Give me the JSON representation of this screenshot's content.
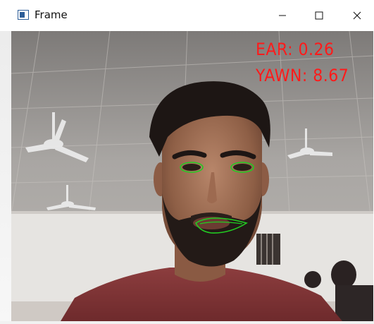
{
  "window": {
    "title": "Frame",
    "icons": {
      "app": "window-app-icon",
      "minimize": "minimize-icon",
      "maximize": "maximize-icon",
      "close": "close-icon"
    }
  },
  "overlay": {
    "ear_text": "EAR: 0.26",
    "yawn_text": "YAWN: 8.67",
    "text_color": "#ff1a1a",
    "contour_color": "#22cc22"
  }
}
